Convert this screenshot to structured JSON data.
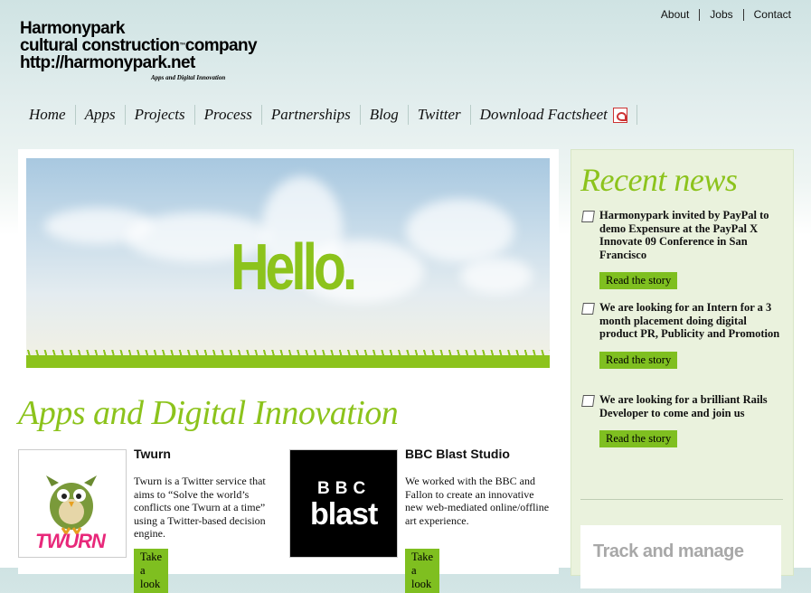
{
  "logo": {
    "line1": "Harmonypark",
    "line2": "cultural construction",
    "tm": "™",
    "line2b": "company",
    "line3": "http://harmonypark.net",
    "tagline": "Apps and Digital Innovation"
  },
  "toplinks": [
    "About",
    "Jobs",
    "Contact"
  ],
  "nav": [
    "Home",
    "Apps",
    "Projects",
    "Process",
    "Partnerships",
    "Blog",
    "Twitter",
    "Download Factsheet"
  ],
  "hero": {
    "text": "Hello."
  },
  "section_title": "Apps and Digital Innovation",
  "apps": [
    {
      "title": "Twurn",
      "desc": "Twurn is a Twitter service that aims to “Solve the world’s conflicts one Twurn at a time” using a Twitter-based decision engine.",
      "button": "Take a look",
      "thumb_text": "TWURN"
    },
    {
      "title": "BBC Blast Studio",
      "desc": "We worked with the BBC and Fallon to create an innovative new web-mediated online/offline art experience.",
      "button": "Take a look",
      "thumb_text_top": "BBC",
      "thumb_text_bottom": "blast"
    }
  ],
  "sidebar": {
    "title": "Recent news",
    "items": [
      {
        "text": "Harmonypark invited by PayPal to demo Expensure at the PayPal X Innovate 09 Conference in San Francisco",
        "button": "Read the story"
      },
      {
        "text": "We are looking for an Intern for a 3 month placement doing digital product PR, Publicity and Promotion",
        "button": "Read the story"
      },
      {
        "text": "We are looking for a brilliant Rails Developer to come and join us",
        "button": "Read the story"
      }
    ],
    "promo": "Track and manage"
  },
  "colors": {
    "accent": "#8cc31c",
    "button": "#7fbf20"
  }
}
